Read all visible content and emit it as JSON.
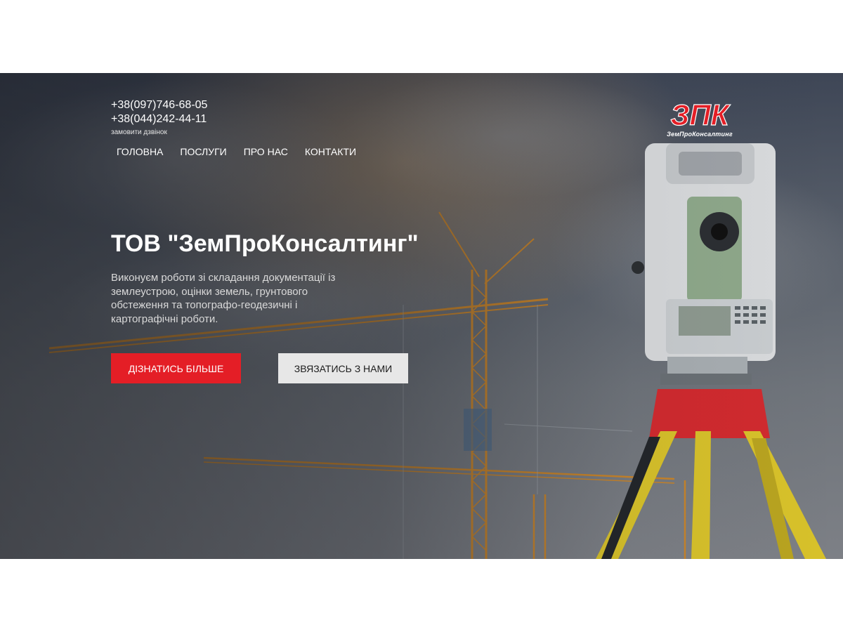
{
  "header": {
    "phones": [
      "+38(097)746-68-05",
      "+38(044)242-44-11"
    ],
    "callback_label": "замовити дзвінок"
  },
  "nav": {
    "items": [
      {
        "label": "ГОЛОВНА"
      },
      {
        "label": "ПОСЛУГИ"
      },
      {
        "label": "ПРО НАС"
      },
      {
        "label": "КОНТАКТИ"
      }
    ]
  },
  "logo": {
    "mark": "ЗПК",
    "name": "ЗемПроКонсалтинг",
    "colors": {
      "accent": "#e41e26",
      "white": "#ffffff"
    }
  },
  "hero": {
    "title": "ТОВ \"ЗемПроКонсалтинг\"",
    "description": "Виконуєм роботи зі складання документації із землеустрою, оцінки земель, грунтового обстеження та топографо-геодезичні і картографічні роботи.",
    "primary_button": "ДІЗНАТИСЬ БІЛЬШЕ",
    "secondary_button": "ЗВЯЗАТИСЬ З НАМИ",
    "colors": {
      "primary_button": "#e41e26",
      "secondary_button": "#e7e7e7"
    }
  }
}
